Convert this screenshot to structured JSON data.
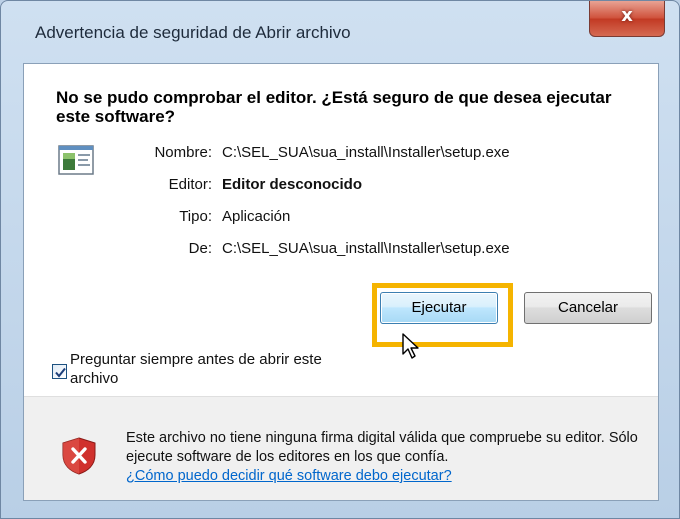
{
  "window": {
    "title": "Advertencia de seguridad de Abrir archivo",
    "close_glyph": "x"
  },
  "dialog": {
    "heading": "No se pudo comprobar el editor. ¿Está seguro de que desea ejecutar este software?",
    "file_icon": "program-window-icon",
    "info": [
      {
        "label": "Nombre:",
        "value": "C:\\SEL_SUA\\sua_install\\Installer\\setup.exe",
        "bold": false
      },
      {
        "label": "Editor:",
        "value": "Editor desconocido",
        "bold": true
      },
      {
        "label": "Tipo:",
        "value": "Aplicación",
        "bold": false
      },
      {
        "label": "De:",
        "value": "C:\\SEL_SUA\\sua_install\\Installer\\setup.exe",
        "bold": false
      }
    ],
    "buttons": {
      "run_label": "Ejecutar",
      "cancel_label": "Cancelar"
    },
    "checkbox": {
      "label": "Preguntar siempre antes de abrir este archivo",
      "checked": true
    }
  },
  "footer": {
    "icon": "shield-error-icon",
    "text": "Este archivo no tiene ninguna firma digital válida que compruebe su editor. Sólo ejecute software de los editores en los que confía.",
    "link_text": "¿Cómo puedo decidir qué software debo ejecutar?"
  },
  "colors": {
    "highlight": "#f5b400",
    "link": "#0066cc",
    "shield": "#d0312d"
  }
}
